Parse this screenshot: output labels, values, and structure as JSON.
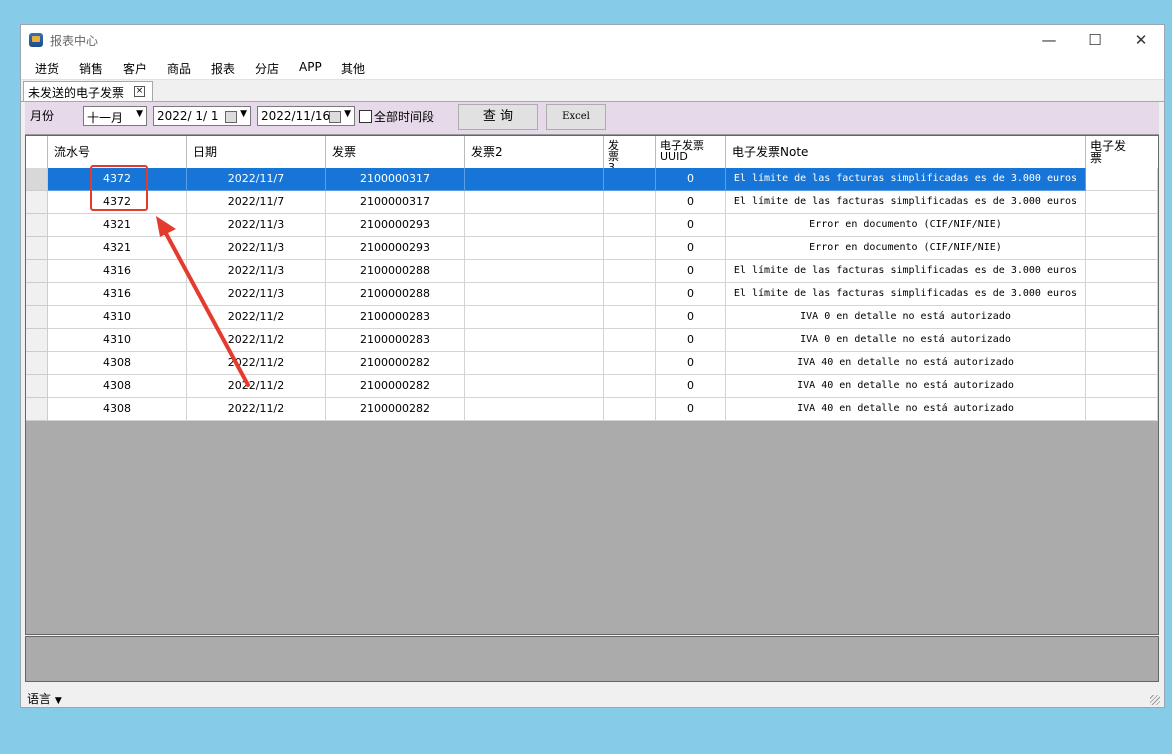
{
  "window": {
    "title": "报表中心"
  },
  "menu": [
    "进货",
    "销售",
    "客户",
    "商品",
    "报表",
    "分店",
    "APP",
    "其他"
  ],
  "tab": {
    "label": "未发送的电子发票"
  },
  "toolbar": {
    "month_label": "月份",
    "month_value": "十一月",
    "date_from": "2022/ 1/ 1",
    "date_to": "2022/11/16",
    "all_time_label": "全部时间段",
    "query_label": "查 询",
    "excel_label": "Excel"
  },
  "table": {
    "columns": [
      "流水号",
      "日期",
      "发票",
      "发票2",
      "发票3",
      "电子发票UUID",
      "电子发票Note",
      "电子发票"
    ],
    "rows": [
      [
        "4372",
        "2022/11/7",
        "2100000317",
        "",
        "",
        "0",
        "El límite de las facturas simplificadas es de 3.000 euros",
        ""
      ],
      [
        "4372",
        "2022/11/7",
        "2100000317",
        "",
        "",
        "0",
        "El límite de las facturas simplificadas es de 3.000 euros",
        ""
      ],
      [
        "4321",
        "2022/11/3",
        "2100000293",
        "",
        "",
        "0",
        "Error en documento (CIF/NIF/NIE)",
        ""
      ],
      [
        "4321",
        "2022/11/3",
        "2100000293",
        "",
        "",
        "0",
        "Error en documento (CIF/NIF/NIE)",
        ""
      ],
      [
        "4316",
        "2022/11/3",
        "2100000288",
        "",
        "",
        "0",
        "El límite de las facturas simplificadas es de 3.000 euros",
        ""
      ],
      [
        "4316",
        "2022/11/3",
        "2100000288",
        "",
        "",
        "0",
        "El límite de las facturas simplificadas es de 3.000 euros",
        ""
      ],
      [
        "4310",
        "2022/11/2",
        "2100000283",
        "",
        "",
        "0",
        "IVA 0 en detalle no está autorizado",
        ""
      ],
      [
        "4310",
        "2022/11/2",
        "2100000283",
        "",
        "",
        "0",
        "IVA 0 en detalle no está autorizado",
        ""
      ],
      [
        "4308",
        "2022/11/2",
        "2100000282",
        "",
        "",
        "0",
        "IVA 40 en detalle no está autorizado",
        ""
      ],
      [
        "4308",
        "2022/11/2",
        "2100000282",
        "",
        "",
        "0",
        "IVA 40 en detalle no está autorizado",
        ""
      ],
      [
        "4308",
        "2022/11/2",
        "2100000282",
        "",
        "",
        "0",
        "IVA 40 en detalle no está autorizado",
        ""
      ]
    ],
    "selected_row": 0
  },
  "status": {
    "language_label": "语言"
  },
  "colors": {
    "selection": "#1775d8",
    "annotation": "#e53b2f",
    "toolbar_bg": "#e6d9ea"
  }
}
